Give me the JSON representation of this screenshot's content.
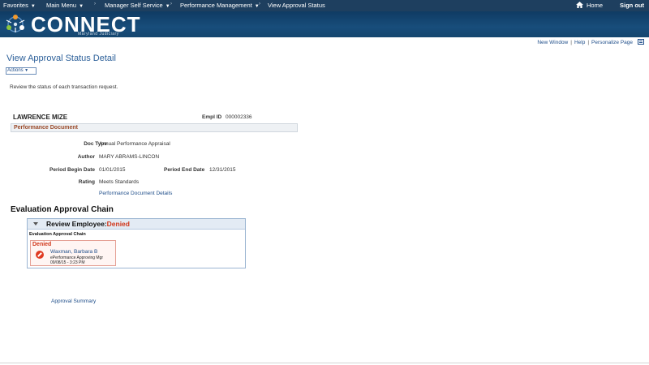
{
  "navbar": {
    "favorites": "Favorites",
    "main_menu": "Main Menu",
    "manager_self_service": "Manager Self Service",
    "performance_management": "Performance Management",
    "view_approval_status": "View Approval Status",
    "home": "Home",
    "sign_out": "Sign out"
  },
  "banner": {
    "logo_text": "CONNECT",
    "logo_sub": "Maryland Judiciary"
  },
  "page_links": {
    "new_window": "New Window",
    "help": "Help",
    "personalize_page": "Personalize Page"
  },
  "page": {
    "title": "View Approval Status Detail",
    "actions_label": "Actions",
    "instructions": "Review the status of each transaction request."
  },
  "employee": {
    "name": "LAWRENCE MIZE",
    "empl_id_label": "Empl ID",
    "empl_id": "000002336"
  },
  "document": {
    "section_title": "Performance Document",
    "doc_type_label": "Doc Type",
    "doc_type": "Annual Performance Appraisal",
    "author_label": "Author",
    "author": "MARY ABRAMS-LINCON",
    "period_begin_label": "Period Begin Date",
    "period_begin": "01/01/2015",
    "period_end_label": "Period End Date",
    "period_end": "12/31/2015",
    "rating_label": "Rating",
    "rating": "Meets Standards",
    "details_link": "Performance Document Details"
  },
  "chain": {
    "title": "Evaluation Approval Chain",
    "step_label": "Review Employee:",
    "step_status": "Denied",
    "sub_title": "Evaluation Approval Chain",
    "card_state": "Denied",
    "approver": "Waxman, Barbara B",
    "role": "ePerformance Approving Mgr",
    "date": "09/08/15 - 3:23 PM"
  },
  "footer": {
    "approval_summary": "Approval Summary"
  },
  "colors": {
    "nav_bg": "#1e3f5f",
    "banner_bg": "#184d7b",
    "link": "#1f4e8a",
    "denied": "#d1361a",
    "section_title": "#9a4a2a"
  }
}
